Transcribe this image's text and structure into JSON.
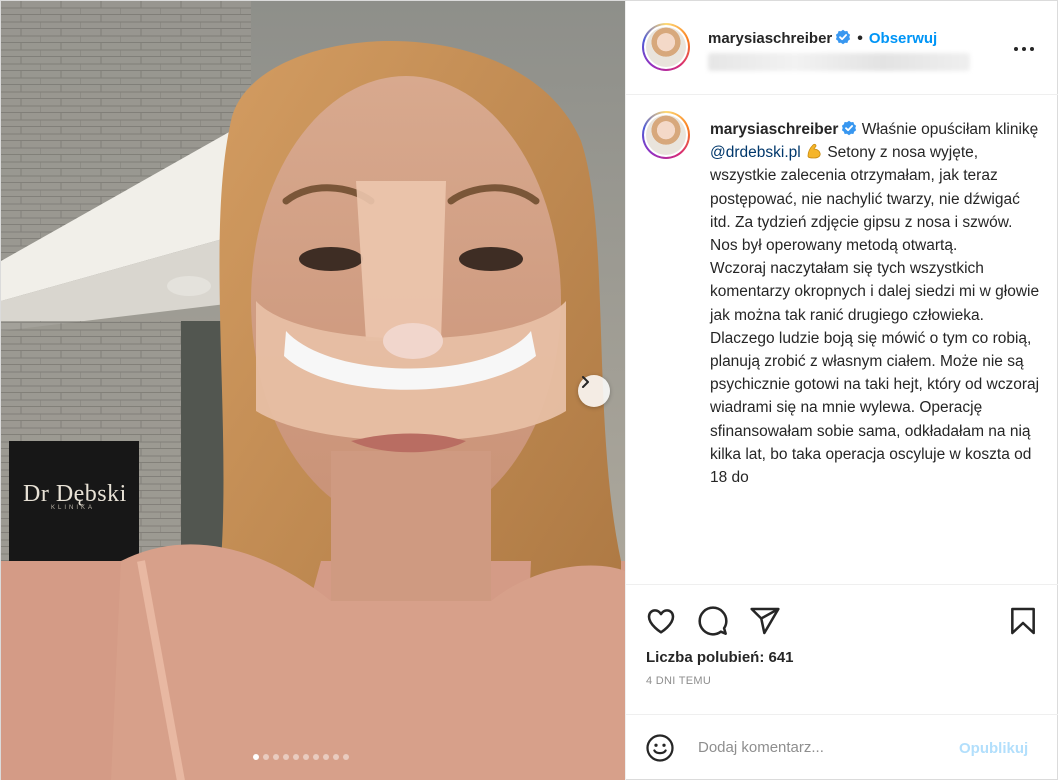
{
  "photo": {
    "alt_sign_text": "Dr Dębski",
    "sign_subtext": "KLINIKA",
    "carousel": {
      "total": 10,
      "active": 1
    }
  },
  "header": {
    "username": "marysiaschreiber",
    "separator": "•",
    "follow_label": "Obserwuj"
  },
  "caption": {
    "username": "marysiaschreiber",
    "text_before_mention": "Właśnie opuściłam klinikę",
    "mention": "@drdebski.pl",
    "text_after_mention": "Setony z nosa wyjęte, wszystkie zalecenia otrzymałam, jak teraz postępować, nie nachylić twarzy, nie dźwigać itd. Za tydzień zdjęcie gipsu z nosa i szwów. Nos był operowany metodą otwartą.",
    "paragraph_2": "Wczoraj naczytałam się tych wszystkich komentarzy okropnych i dalej siedzi mi w głowie jak można tak ranić drugiego człowieka. Dlaczego ludzie boją się mówić o tym co robią, planują zrobić z własnym ciałem. Może nie są psychicznie gotowi na taki hejt, który od wczoraj wiadrami się na mnie wylewa. Operację sfinansowałam sobie sama, odkładałam na nią kilka lat, bo taka operacja oscyluje w koszta od 18 do"
  },
  "actions": {
    "likes_text": "Liczba polubień: 641",
    "date_text": "4 DNI TEMU"
  },
  "comment": {
    "placeholder": "Dodaj komentarz...",
    "publish_label": "Opublikuj"
  },
  "colors": {
    "accent": "#0095f6",
    "verified": "#3897f0",
    "muted": "#8e8e8e"
  },
  "icons": [
    "verified-badge-icon",
    "more-options-icon",
    "heart-icon",
    "comment-icon",
    "share-icon",
    "bookmark-icon",
    "emoji-icon",
    "chevron-right-icon",
    "flexed-biceps-icon"
  ]
}
